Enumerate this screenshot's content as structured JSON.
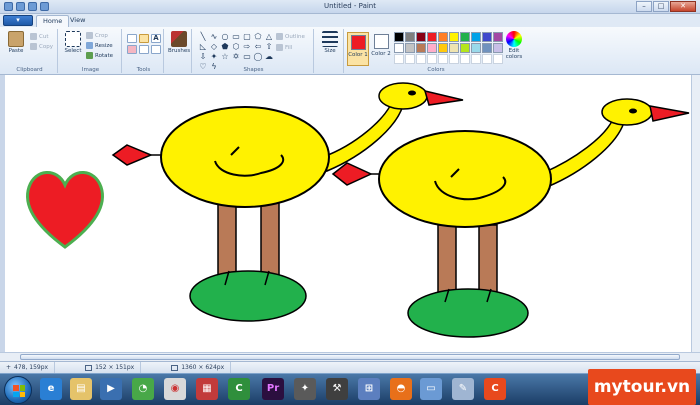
{
  "window": {
    "title": "Untitled - Paint",
    "minimize": "–",
    "maximize": "□",
    "close": "✕"
  },
  "tabs": {
    "menu": "▾",
    "home": "Home",
    "view": "View"
  },
  "ribbon": {
    "clipboard": {
      "label": "Clipboard",
      "paste": "Paste",
      "cut": "Cut",
      "copy": "Copy"
    },
    "image": {
      "label": "Image",
      "select": "Select",
      "crop": "Crop",
      "resize": "Resize",
      "rotate": "Rotate"
    },
    "tools": {
      "label": "Tools",
      "text_tool": "A"
    },
    "brushes": {
      "label": "Brushes"
    },
    "shapes": {
      "label": "Shapes",
      "outline": "Outline",
      "fill": "Fill"
    },
    "size": {
      "label": "Size"
    },
    "colors": {
      "label": "Colors",
      "color1": "Color 1",
      "color2": "Color 2",
      "edit": "Edit colors",
      "color1_value": "#ed1c24",
      "color2_value": "#ffffff"
    }
  },
  "palette": [
    "#000000",
    "#7f7f7f",
    "#880015",
    "#ed1c24",
    "#ff7f27",
    "#fff200",
    "#22b14c",
    "#00a2e8",
    "#3f48cc",
    "#a349a4",
    "#ffffff",
    "#c3c3c3",
    "#b97a57",
    "#ffaec9",
    "#ffc90e",
    "#efe4b0",
    "#b5e61d",
    "#99d9ea",
    "#7092be",
    "#c8bfe7"
  ],
  "status": {
    "cursor_pos": "478, 159px",
    "selection_size": "152 × 151px",
    "image_size": "1360 × 624px"
  },
  "watermark": "mytour.vn",
  "drawing": {
    "heart_color": "#ed1c24",
    "heart_outline": "#4caf50",
    "body_color": "#fff200",
    "beak_color": "#ed1c24",
    "leg_color": "#b97a57",
    "ground_color": "#22b14c"
  }
}
